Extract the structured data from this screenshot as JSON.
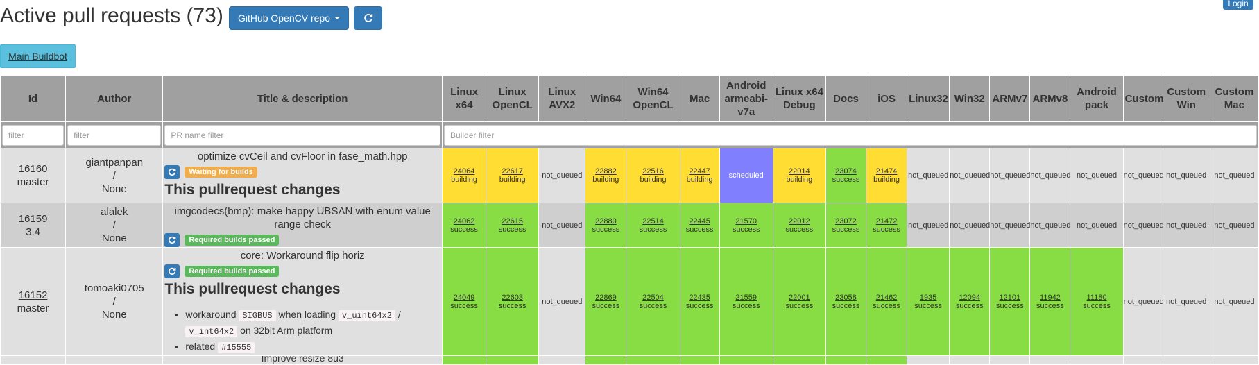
{
  "header": {
    "title": "Active pull requests (73)",
    "repo_button": "GitHub OpenCV repo",
    "login": "Login",
    "main_buildbot": "Main Buildbot"
  },
  "columns": {
    "id": "Id",
    "author": "Author",
    "title": "Title & description",
    "builders": [
      "Linux x64",
      "Linux OpenCL",
      "Linux AVX2",
      "Win64",
      "Win64 OpenCL",
      "Mac",
      "Android armeabi-v7a",
      "Linux x64 Debug",
      "Docs",
      "iOS",
      "Linux32",
      "Win32",
      "ARMv7",
      "ARMv8",
      "Android pack",
      "Custom",
      "Custom Win",
      "Custom Mac"
    ]
  },
  "filters": {
    "id": "filter",
    "author": "filter",
    "title": "PR name filter",
    "builder": "Builder filter"
  },
  "rows": [
    {
      "id": "16160",
      "branch": "master",
      "author": "giantpanpan",
      "slash": "/",
      "assignee": "None",
      "title": "optimize cvCeil and cvFloor in fase_math.hpp",
      "label": "Waiting for builds",
      "label_type": "warn",
      "desc_head": "This pullrequest changes",
      "builds": [
        {
          "n": "24064",
          "s": "building"
        },
        {
          "n": "22617",
          "s": "building"
        },
        {
          "n": "",
          "s": "not_queued"
        },
        {
          "n": "22882",
          "s": "building"
        },
        {
          "n": "22516",
          "s": "building"
        },
        {
          "n": "22447",
          "s": "building"
        },
        {
          "n": "",
          "s": "scheduled"
        },
        {
          "n": "22014",
          "s": "building"
        },
        {
          "n": "23074",
          "s": "success"
        },
        {
          "n": "21474",
          "s": "building"
        },
        {
          "n": "",
          "s": "not_queued"
        },
        {
          "n": "",
          "s": "not_queued"
        },
        {
          "n": "",
          "s": "not_queued"
        },
        {
          "n": "",
          "s": "not_queued"
        },
        {
          "n": "",
          "s": "not_queued"
        },
        {
          "n": "",
          "s": "not_queued"
        },
        {
          "n": "",
          "s": "not_queued"
        },
        {
          "n": "",
          "s": "not_queued"
        }
      ]
    },
    {
      "id": "16159",
      "branch": "3.4",
      "author": "alalek",
      "slash": "/",
      "assignee": "None",
      "title": "imgcodecs(bmp): make happy UBSAN with enum value range check",
      "label": "Required builds passed",
      "label_type": "ok",
      "builds": [
        {
          "n": "24062",
          "s": "success"
        },
        {
          "n": "22615",
          "s": "success"
        },
        {
          "n": "",
          "s": "not_queued"
        },
        {
          "n": "22880",
          "s": "success"
        },
        {
          "n": "22514",
          "s": "success"
        },
        {
          "n": "22445",
          "s": "success"
        },
        {
          "n": "21570",
          "s": "success"
        },
        {
          "n": "22012",
          "s": "success"
        },
        {
          "n": "23072",
          "s": "success"
        },
        {
          "n": "21472",
          "s": "success"
        },
        {
          "n": "",
          "s": "not_queued"
        },
        {
          "n": "",
          "s": "not_queued"
        },
        {
          "n": "",
          "s": "not_queued"
        },
        {
          "n": "",
          "s": "not_queued"
        },
        {
          "n": "",
          "s": "not_queued"
        },
        {
          "n": "",
          "s": "not_queued"
        },
        {
          "n": "",
          "s": "not_queued"
        },
        {
          "n": "",
          "s": "not_queued"
        }
      ]
    },
    {
      "id": "16152",
      "branch": "master",
      "author": "tomoaki0705",
      "slash": "/",
      "assignee": "None",
      "title": "core: Workaround flip horiz",
      "label": "Required builds passed",
      "label_type": "ok",
      "desc_head": "This pullrequest changes",
      "bullet1_a": "workaround",
      "bullet1_code": "SIGBUS",
      "bullet1_b": "when loading",
      "bullet1_code2": "v_uint64x2",
      "bullet1_sep": "/",
      "bullet1_code3": "v_int64x2",
      "bullet1_c": "on 32bit Arm platform",
      "bullet2_a": "related",
      "bullet2_code": "#15555",
      "builds": [
        {
          "n": "24049",
          "s": "success"
        },
        {
          "n": "22603",
          "s": "success"
        },
        {
          "n": "",
          "s": "not_queued"
        },
        {
          "n": "22869",
          "s": "success"
        },
        {
          "n": "22504",
          "s": "success"
        },
        {
          "n": "22435",
          "s": "success"
        },
        {
          "n": "21559",
          "s": "success"
        },
        {
          "n": "22001",
          "s": "success"
        },
        {
          "n": "23058",
          "s": "success"
        },
        {
          "n": "21462",
          "s": "success"
        },
        {
          "n": "1935",
          "s": "success"
        },
        {
          "n": "12094",
          "s": "success"
        },
        {
          "n": "12101",
          "s": "success"
        },
        {
          "n": "11942",
          "s": "success"
        },
        {
          "n": "11180",
          "s": "success"
        },
        {
          "n": "",
          "s": "not_queued"
        },
        {
          "n": "",
          "s": "not_queued"
        },
        {
          "n": "",
          "s": "not_queued"
        }
      ]
    },
    {
      "title_partial": "Improve resize 8u3"
    }
  ]
}
